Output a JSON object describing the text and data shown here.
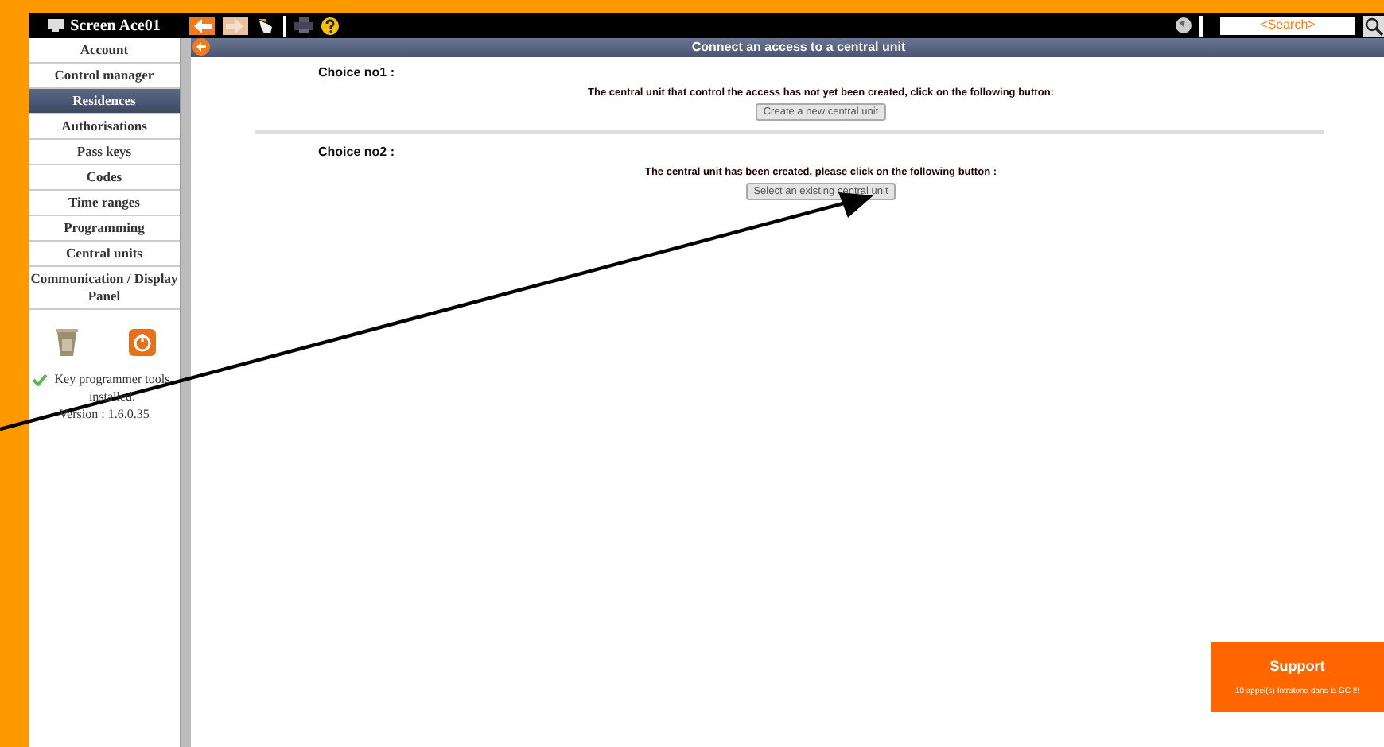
{
  "header": {
    "screen_label": "Screen Ace01",
    "search": {
      "placeholder": "<Search>"
    }
  },
  "sidebar": {
    "items": [
      {
        "label": "Account",
        "selected": false
      },
      {
        "label": "Control manager",
        "selected": false
      },
      {
        "label": "Residences",
        "selected": true
      },
      {
        "label": "Authorisations",
        "selected": false
      },
      {
        "label": "Pass keys",
        "selected": false
      },
      {
        "label": "Codes",
        "selected": false
      },
      {
        "label": "Time ranges",
        "selected": false
      },
      {
        "label": "Programming",
        "selected": false
      },
      {
        "label": "Central units",
        "selected": false
      },
      {
        "label": "Communication / Display Panel",
        "selected": false
      }
    ],
    "status": "Key programmer tools installed.",
    "version": "Version : 1.6.0.35"
  },
  "page": {
    "title": "Connect an access to a central unit",
    "choices": [
      {
        "label": "Choice no1 :",
        "message": "The central unit that control the access has not yet been created, click on the following button:",
        "button": "Create a new central unit"
      },
      {
        "label": "Choice no2 :",
        "message": "The central unit has been created, please click on the following button :",
        "button": "Select an existing central unit"
      }
    ]
  },
  "support": {
    "title": "Support",
    "message": "10 appel(s) Intratone dans la GC !!!"
  }
}
